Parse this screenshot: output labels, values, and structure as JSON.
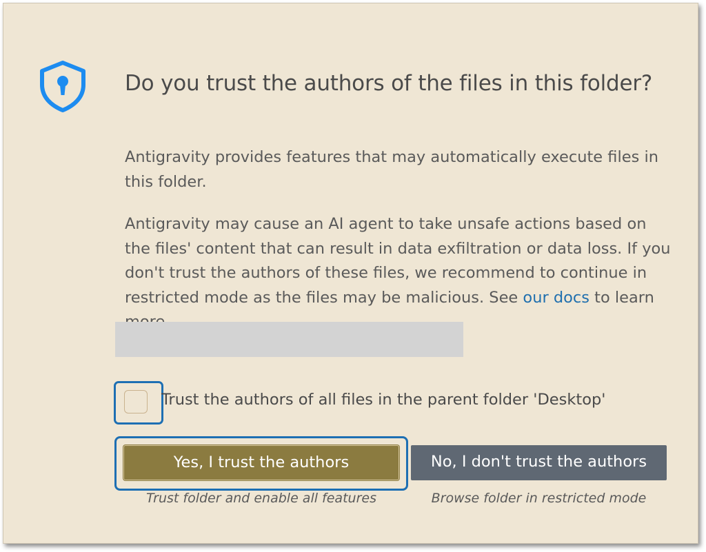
{
  "dialog": {
    "title": "Do you trust the authors of the files in this folder?",
    "paragraph1": "Antigravity provides features that may automatically execute files in this folder.",
    "paragraph2_before_link": "Antigravity may cause an AI agent to take unsafe actions based on the files' content that can result in data exfiltration or data loss. If you don't trust the authors of these files, we recommend to continue in restricted mode as the files may be malicious. See ",
    "paragraph2_link": "our docs",
    "paragraph2_after_link": " to learn more.",
    "checkbox": {
      "label": "Trust the authors of all files in the parent folder 'Desktop'",
      "checked": false
    },
    "buttons": {
      "trust_label": "Yes, I trust the authors",
      "trust_hint": "Trust folder and enable all features",
      "restrict_label": "No, I don't trust the authors",
      "restrict_hint": "Browse folder in restricted mode"
    },
    "icon": "shield-lock-icon"
  },
  "colors": {
    "background": "#efe6d4",
    "accent_blue": "#1d6fb3",
    "primary_button": "#8b7b40",
    "secondary_button": "#5f6873",
    "link": "#1f6fae"
  }
}
